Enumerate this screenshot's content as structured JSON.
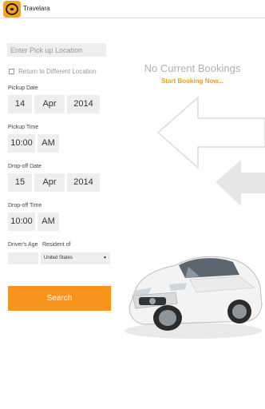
{
  "app": {
    "title": "Travelara"
  },
  "form": {
    "pickup_placeholder": "Enter Pick up Location",
    "return_label": "Return to Different Location",
    "pickup_date_label": "Pickup Date",
    "pickup_date": {
      "day": "14",
      "month": "Apr",
      "year": "2014"
    },
    "pickup_time_label": "Pickup Time",
    "pickup_time": {
      "time": "10:00",
      "ampm": "AM"
    },
    "dropoff_date_label": "Drop-off Date",
    "dropoff_date": {
      "day": "15",
      "month": "Apr",
      "year": "2014"
    },
    "dropoff_time_label": "Drop-off Time",
    "dropoff_time": {
      "time": "10:00",
      "ampm": "AM"
    },
    "age_label": "Driver's Age",
    "resident_label": "Resident of",
    "resident_value": "United States",
    "search_label": "Search"
  },
  "bookings": {
    "empty_title": "No Current Bookings",
    "start_link": "Start Booking Now..."
  },
  "colors": {
    "accent": "#f7941d",
    "link": "#f0a010"
  }
}
